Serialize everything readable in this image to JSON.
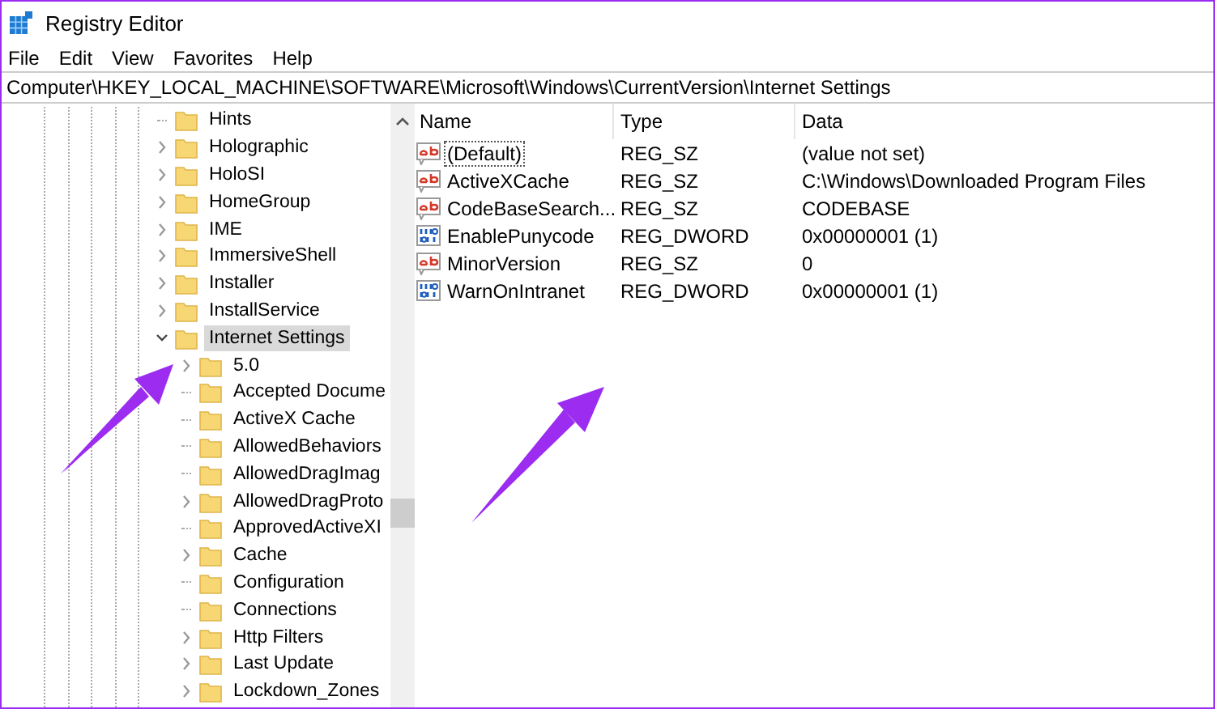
{
  "window": {
    "title": "Registry Editor"
  },
  "menu": [
    "File",
    "Edit",
    "View",
    "Favorites",
    "Help"
  ],
  "address": "Computer\\HKEY_LOCAL_MACHINE\\SOFTWARE\\Microsoft\\Windows\\CurrentVersion\\Internet Settings",
  "tree": [
    {
      "label": "Hints",
      "expandable": false,
      "selected": false
    },
    {
      "label": "Holographic",
      "expandable": true,
      "expanded": false,
      "selected": false
    },
    {
      "label": "HoloSI",
      "expandable": true,
      "expanded": false,
      "selected": false
    },
    {
      "label": "HomeGroup",
      "expandable": true,
      "expanded": false,
      "selected": false
    },
    {
      "label": "IME",
      "expandable": true,
      "expanded": false,
      "selected": false
    },
    {
      "label": "ImmersiveShell",
      "expandable": true,
      "expanded": false,
      "selected": false
    },
    {
      "label": "Installer",
      "expandable": true,
      "expanded": false,
      "selected": false
    },
    {
      "label": "InstallService",
      "expandable": true,
      "expanded": false,
      "selected": false
    },
    {
      "label": "Internet Settings",
      "expandable": true,
      "expanded": true,
      "selected": true,
      "children": [
        {
          "label": "5.0",
          "expandable": true,
          "expanded": false,
          "selected": false
        },
        {
          "label": "Accepted Docume",
          "expandable": false,
          "selected": false
        },
        {
          "label": "ActiveX Cache",
          "expandable": false,
          "selected": false
        },
        {
          "label": "AllowedBehaviors",
          "expandable": false,
          "selected": false
        },
        {
          "label": "AllowedDragImag",
          "expandable": false,
          "selected": false
        },
        {
          "label": "AllowedDragProto",
          "expandable": true,
          "expanded": false,
          "selected": false
        },
        {
          "label": "ApprovedActiveXI",
          "expandable": false,
          "selected": false
        },
        {
          "label": "Cache",
          "expandable": true,
          "expanded": false,
          "selected": false
        },
        {
          "label": "Configuration",
          "expandable": false,
          "selected": false
        },
        {
          "label": "Connections",
          "expandable": false,
          "selected": false
        },
        {
          "label": "Http Filters",
          "expandable": true,
          "expanded": false,
          "selected": false
        },
        {
          "label": "Last Update",
          "expandable": true,
          "expanded": false,
          "selected": false
        },
        {
          "label": "Lockdown_Zones",
          "expandable": true,
          "expanded": false,
          "selected": false
        }
      ]
    }
  ],
  "table": {
    "columns": [
      "Name",
      "Type",
      "Data"
    ],
    "rows": [
      {
        "kind": "string",
        "name": "(Default)",
        "type": "REG_SZ",
        "data": "(value not set)",
        "selected": true
      },
      {
        "kind": "string",
        "name": "ActiveXCache",
        "type": "REG_SZ",
        "data": "C:\\Windows\\Downloaded Program Files",
        "selected": false
      },
      {
        "kind": "string",
        "name": "CodeBaseSearch...",
        "type": "REG_SZ",
        "data": "CODEBASE",
        "selected": false
      },
      {
        "kind": "binary",
        "name": "EnablePunycode",
        "type": "REG_DWORD",
        "data": "0x00000001 (1)",
        "selected": false
      },
      {
        "kind": "string",
        "name": "MinorVersion",
        "type": "REG_SZ",
        "data": "0",
        "selected": false
      },
      {
        "kind": "binary",
        "name": "WarnOnIntranet",
        "type": "REG_DWORD",
        "data": "0x00000001 (1)",
        "selected": false
      }
    ]
  }
}
